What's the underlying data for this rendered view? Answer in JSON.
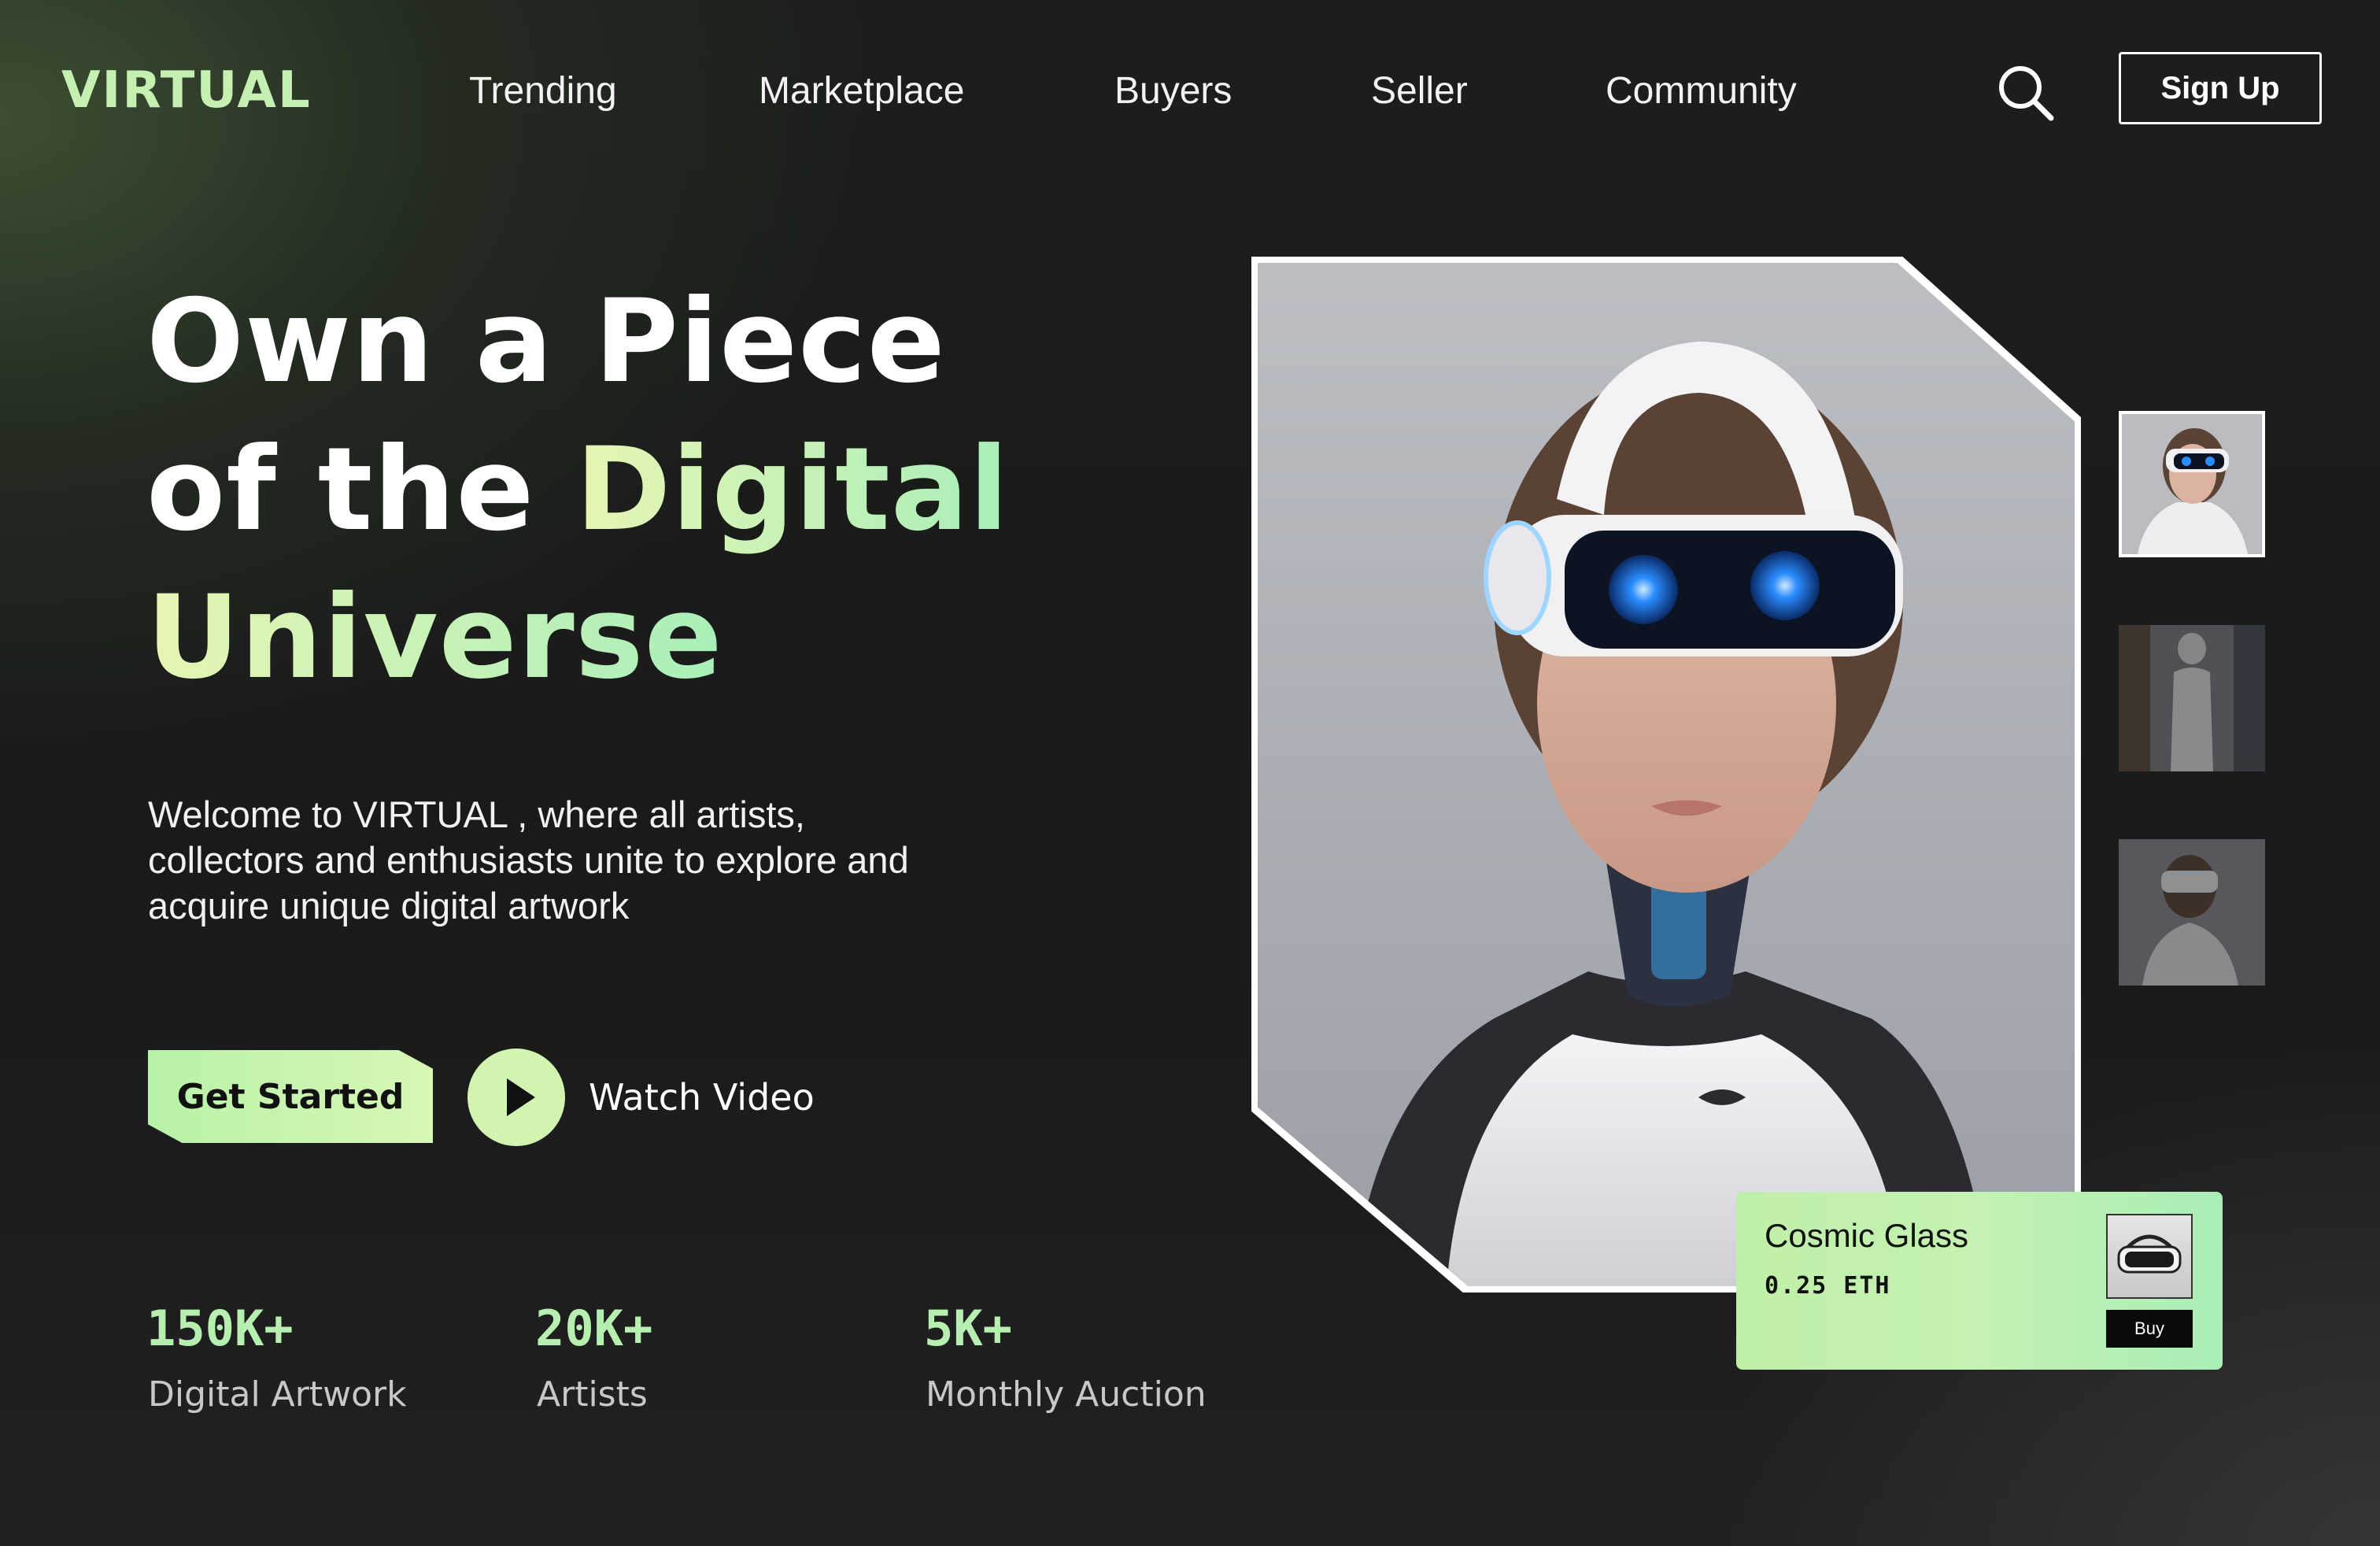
{
  "brand": {
    "name": "VIRTUAL"
  },
  "nav": {
    "items": [
      {
        "label": "Trending"
      },
      {
        "label": "Marketplace"
      },
      {
        "label": "Buyers"
      },
      {
        "label": "Seller"
      },
      {
        "label": "Community"
      }
    ],
    "search_icon": "search-icon",
    "signup_label": "Sign Up"
  },
  "hero": {
    "headline_line1": "Own a Piece",
    "headline_line2_prefix": "of the ",
    "headline_line2_highlight": "Digital",
    "headline_line3": "Universe",
    "intro": "Welcome to VIRTUAL , where all artists, collectors and enthusiasts unite to explore and acquire unique digital artwork",
    "get_started_label": "Get Started",
    "watch_video_label": "Watch Video",
    "play_icon": "play-icon"
  },
  "stats": [
    {
      "value": "150K+",
      "label": "Digital Artwork"
    },
    {
      "value": "20K+",
      "label": "Artists"
    },
    {
      "value": "5K+",
      "label": "Monthly Auction"
    }
  ],
  "gallery": {
    "main_image": "robot-woman-vr-headset-image",
    "thumbnails": [
      {
        "image": "vr-robot-portrait-thumb",
        "selected": true
      },
      {
        "image": "vr-robot-fullbody-thumb",
        "selected": false
      },
      {
        "image": "vr-robot-side-thumb",
        "selected": false
      }
    ]
  },
  "product_card": {
    "title": "Cosmic Glass",
    "price": "0.25 ETH",
    "buy_label": "Buy",
    "thumb_image": "vr-headset-thumb"
  },
  "colors": {
    "accent": "#c6efb2",
    "accent_secondary": "#a9efb9",
    "background": "#1c1e1c",
    "text": "#ffffff"
  }
}
